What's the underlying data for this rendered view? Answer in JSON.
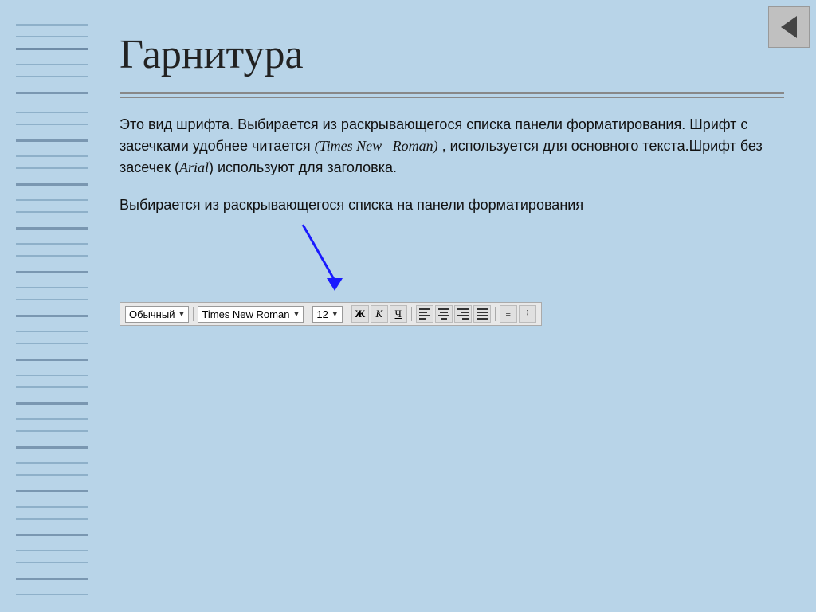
{
  "page": {
    "title": "Гарнитура",
    "background_color": "#b8d4e8"
  },
  "content": {
    "paragraph1": "Это вид шрифта. Выбирается из раскрывающегося списка панели форматирования.  Шрифт с засечками удобнее читается ",
    "italic_text": "(Times New   Roman)",
    "paragraph1_cont": " , используется для основного текста.Шрифт без засечек (",
    "italic_arial": "Arial",
    "paragraph1_end": ") используют для заголовка.",
    "paragraph2": "Выбирается из раскрывающегося списка на панели форматирования"
  },
  "toolbar": {
    "style_label": "Обычный",
    "font_label": "Times New Roman",
    "size_label": "12",
    "bold": "Ж",
    "italic": "К",
    "underline": "Ч"
  },
  "nav": {
    "back_arrow": "◄"
  }
}
